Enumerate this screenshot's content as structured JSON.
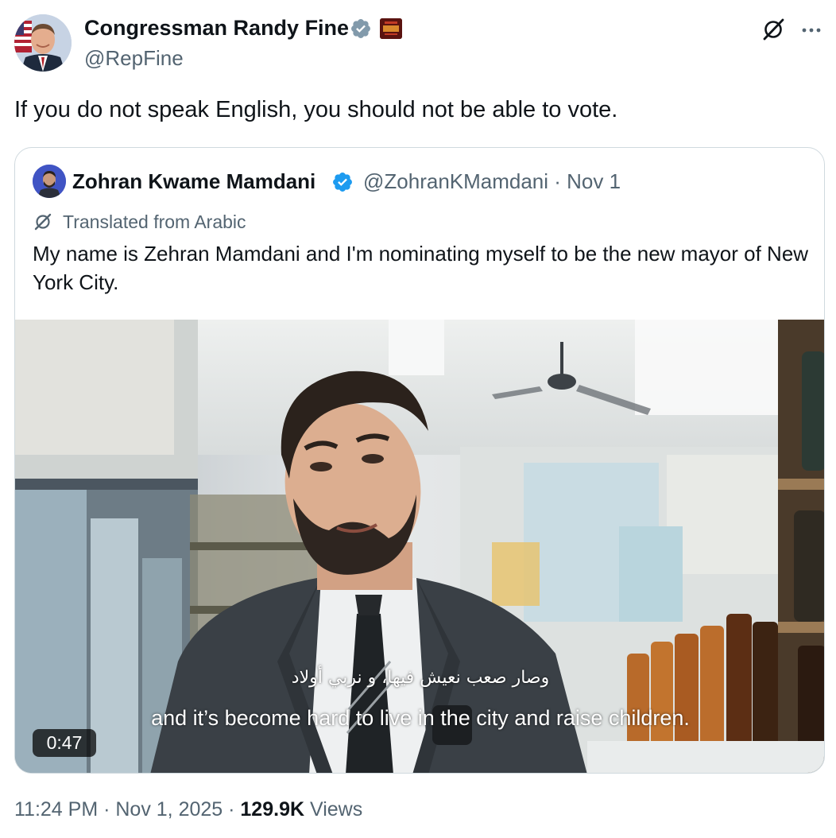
{
  "author": {
    "display_name": "Congressman Randy Fine",
    "handle": "@RepFine",
    "verified_badge": "gray-verified-icon",
    "affiliate_badge": "congress-affiliate-badge"
  },
  "actions": {
    "grok_icon": "grok-icon",
    "more_icon": "more-icon"
  },
  "tweet": {
    "text": "If you do not speak English, you should not be able to vote."
  },
  "quote": {
    "display_name": "Zohran Kwame Mamdani",
    "handle_and_date": "@ZohranKMamdani · Nov 1",
    "verified_badge": "blue-verified-icon",
    "translation_label": "Translated from Arabic",
    "text": "My name is Zehran Mamdani and I'm nominating myself to be the new mayor of New York City.",
    "video": {
      "subtitle_arabic": "وصار صعب نعيش فيها، و نربي أولاد",
      "subtitle_english": "and it’s become hard to live in the city and raise children.",
      "duration": "0:47"
    }
  },
  "footer": {
    "time_date": "11:24 PM · Nov 1, 2025 · ",
    "views_count": "129.9K",
    "views_label": " Views"
  },
  "colors": {
    "text_primary": "#0f1419",
    "text_secondary": "#536471",
    "border": "#cfd9de",
    "verified_blue": "#1d9bf0",
    "verified_gray": "#829aab"
  }
}
